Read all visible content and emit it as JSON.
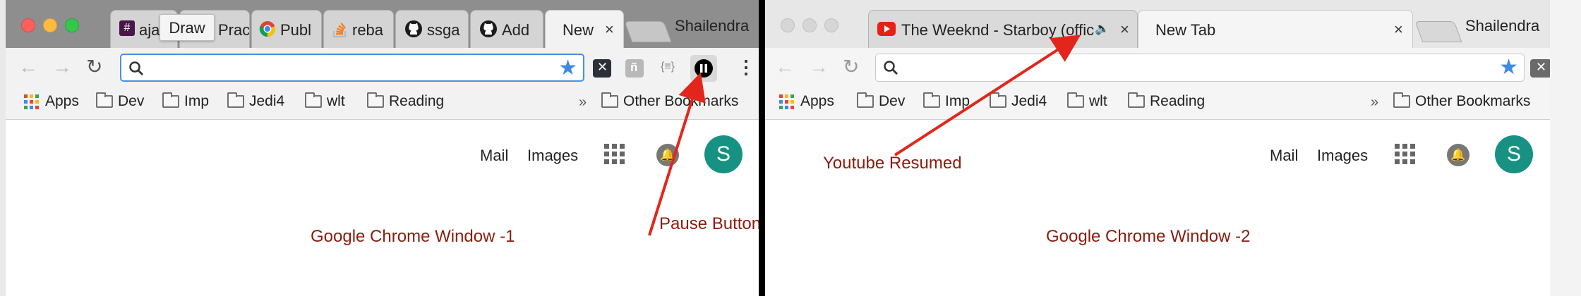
{
  "window1": {
    "tabs": [
      {
        "label": "aja",
        "icon": "slack-hash-icon"
      },
      {
        "label": "Prac",
        "icon": "page-icon"
      },
      {
        "label": "Publ",
        "icon": "chrome-icon"
      },
      {
        "label": "reba",
        "icon": "stackoverflow-icon"
      },
      {
        "label": "ssga",
        "icon": "github-icon"
      },
      {
        "label": "Add",
        "icon": "github-icon"
      },
      {
        "label": "New",
        "icon": "none",
        "close": "×"
      }
    ],
    "profile": "Shailendra",
    "tooltip": "Draw",
    "bookmarks": {
      "apps": "Apps",
      "folders": [
        "Dev",
        "Imp",
        "Jedi4",
        "wlt",
        "Reading"
      ],
      "chevron": "»",
      "other": "Other Bookmarks"
    },
    "content": {
      "mail": "Mail",
      "images": "Images",
      "avatar": "S"
    },
    "annotations": {
      "window_label": "Google Chrome Window -1",
      "pause_label": "Pause Button"
    }
  },
  "window2": {
    "tabs": [
      {
        "label": "The Weeknd - Starboy (offic",
        "icon": "youtube-icon",
        "audio": "🔈",
        "close": "×"
      },
      {
        "label": "New Tab",
        "icon": "none",
        "close": "×"
      }
    ],
    "profile": "Shailendra",
    "bookmarks": {
      "apps": "Apps",
      "folders": [
        "Dev",
        "Imp",
        "Jedi4",
        "wlt",
        "Reading"
      ],
      "chevron": "»",
      "other": "Other Bookmarks"
    },
    "content": {
      "mail": "Mail",
      "images": "Images",
      "avatar": "S"
    },
    "annotations": {
      "window_label": "Google Chrome Window -2",
      "resume_label": "Youtube Resumed"
    }
  },
  "colors": {
    "omnibox_focus": "#4a90e2",
    "avatar": "#179282",
    "annotation": "#8a1d0e",
    "arrow": "#e2261b",
    "star": "#3f8ae0"
  }
}
